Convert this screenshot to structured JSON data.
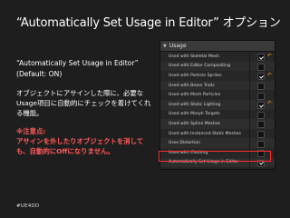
{
  "slide": {
    "title": "“Automatically Set Usage in Editor” オプション",
    "heading_line1": "“Automatically Set Usage in Editor”",
    "heading_line2": "(Default: ON)",
    "body": "オブジェクトにアサインした際に、必要なUsage項目に自動的にチェックを着けてくれる機能。",
    "note_title": "※注意点:",
    "note_body": "アサインを外したりオブジェクトを消しても、自動的にOffになりません。",
    "footer": "#UE4DD"
  },
  "panel": {
    "header": "Usage",
    "rows": [
      {
        "label": "Used with Skeletal Mesh",
        "checked": true,
        "reset": true
      },
      {
        "label": "Used with Editor Compositing",
        "checked": false,
        "reset": false
      },
      {
        "label": "Used with Particle Sprites",
        "checked": true,
        "reset": true
      },
      {
        "label": "Used with Beam Trails",
        "checked": false,
        "reset": false
      },
      {
        "label": "Used with Mesh Particles",
        "checked": false,
        "reset": false
      },
      {
        "label": "Used with Static Lighting",
        "checked": true,
        "reset": true
      },
      {
        "label": "Used with Morph Targets",
        "checked": false,
        "reset": false
      },
      {
        "label": "Used with Spline Meshes",
        "checked": false,
        "reset": false
      },
      {
        "label": "Used with Instanced Static Meshes",
        "checked": false,
        "reset": false
      },
      {
        "label": "Uses Distortion",
        "checked": false,
        "reset": false
      },
      {
        "label": "Used with Clothing",
        "checked": false,
        "reset": false
      },
      {
        "label": "Automatically Set Usage in Editor",
        "checked": true,
        "reset": false
      }
    ]
  },
  "colors": {
    "background": "#1e1e1e",
    "accent_red": "#ff2a2a",
    "reset_orange": "#e7a21c"
  },
  "icons": {
    "collapse": "caret-down-icon",
    "reset": "reset-arrow-icon",
    "checkbox": "checkbox-icon"
  }
}
